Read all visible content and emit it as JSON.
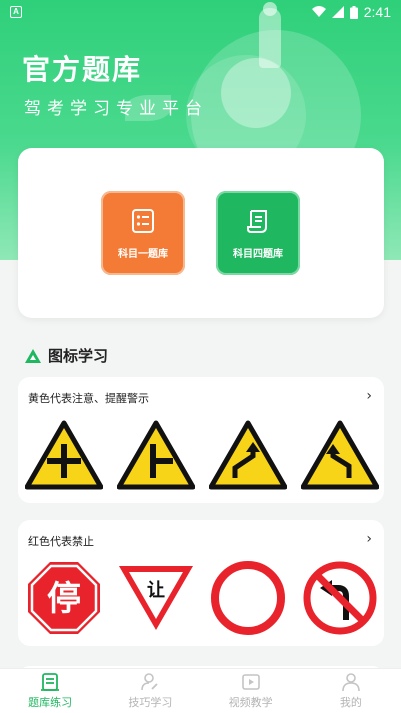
{
  "status_bar": {
    "left_icon": "A",
    "time": "2:41"
  },
  "header": {
    "title": "官方题库",
    "subtitle": "驾考学习专业平台"
  },
  "quiz": {
    "subject1": {
      "label": "科目一题库",
      "icon": "checklist-icon",
      "color": "#f47b35"
    },
    "subject4": {
      "label": "科目四题库",
      "icon": "scroll-icon",
      "color": "#1fb760"
    }
  },
  "section": {
    "title": "图标学习"
  },
  "cards": [
    {
      "title": "黄色代表注意、提醒警示",
      "signs": [
        "crossroads-warning-sign",
        "t-junction-warning-sign",
        "curve-right-warning-sign",
        "curve-left-warning-sign"
      ]
    },
    {
      "title": "红色代表禁止",
      "signs": [
        "stop-sign",
        "yield-sign",
        "no-entry-sign",
        "no-left-turn-sign"
      ],
      "sign_text": {
        "stop": "停",
        "yield": "让"
      }
    }
  ],
  "tabs": [
    {
      "label": "题库练习",
      "icon": "question-bank-icon",
      "active": true
    },
    {
      "label": "技巧学习",
      "icon": "user-edit-icon",
      "active": false
    },
    {
      "label": "视频教学",
      "icon": "video-icon",
      "active": false
    },
    {
      "label": "我的",
      "icon": "profile-icon",
      "active": false
    }
  ],
  "colors": {
    "primary": "#1fb760",
    "orange": "#f47b35",
    "warning_yellow": "#f7d417",
    "prohibit_red": "#e8232b"
  }
}
